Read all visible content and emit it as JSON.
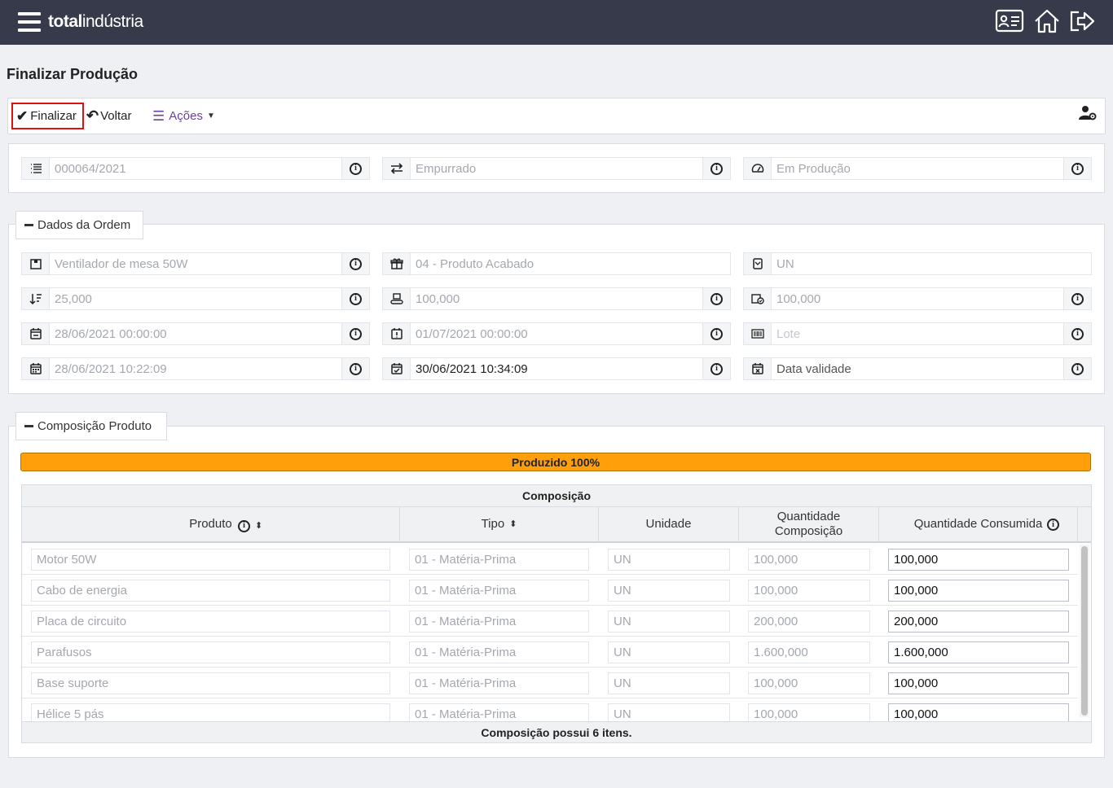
{
  "app": {
    "logo_bold": "total",
    "logo_light": "indústria"
  },
  "page": {
    "title": "Finalizar Produção"
  },
  "toolbar": {
    "finalizar": "Finalizar",
    "voltar": "Voltar",
    "acoes": "Ações"
  },
  "status_fields": {
    "order_number": "000064/2021",
    "flow_type": "Empurrado",
    "status": "Em Produção"
  },
  "dados_ordem": {
    "legend": "Dados da Ordem",
    "product": "Ventilador de mesa 50W",
    "product_type": "04 - Produto Acabado",
    "unit": "UN",
    "qty_min": "25,000",
    "qty_planned": "100,000",
    "qty_produced": "100,000",
    "planned_start": "28/06/2021 00:00:00",
    "planned_end": "01/07/2021 00:00:00",
    "lote_placeholder": "Lote",
    "actual_start": "28/06/2021 10:22:09",
    "actual_end": "30/06/2021 10:34:09",
    "validade_placeholder": "Data validade"
  },
  "composicao": {
    "legend": "Composição Produto",
    "progress_label": "Produzido 100%",
    "progress_percent": 100,
    "grid_title": "Composição",
    "columns": [
      "Produto",
      "Tipo",
      "Unidade",
      "Quantidade Composição",
      "Quantidade Consumida"
    ],
    "rows": [
      {
        "produto": "Motor 50W",
        "tipo": "01 - Matéria-Prima",
        "unidade": "UN",
        "qtd_comp": "100,000",
        "qtd_cons": "100,000"
      },
      {
        "produto": "Cabo de energia",
        "tipo": "01 - Matéria-Prima",
        "unidade": "UN",
        "qtd_comp": "100,000",
        "qtd_cons": "100,000"
      },
      {
        "produto": "Placa de circuito",
        "tipo": "01 - Matéria-Prima",
        "unidade": "UN",
        "qtd_comp": "200,000",
        "qtd_cons": "200,000"
      },
      {
        "produto": "Parafusos",
        "tipo": "01 - Matéria-Prima",
        "unidade": "UN",
        "qtd_comp": "1.600,000",
        "qtd_cons": "1.600,000"
      },
      {
        "produto": "Base suporte",
        "tipo": "01 - Matéria-Prima",
        "unidade": "UN",
        "qtd_comp": "100,000",
        "qtd_cons": "100,000"
      },
      {
        "produto": "Hélice 5 pás",
        "tipo": "01 - Matéria-Prima",
        "unidade": "UN",
        "qtd_comp": "100,000",
        "qtd_cons": "100,000"
      }
    ],
    "footer": "Composição possui 6 itens."
  },
  "colors": {
    "topbar": "#363a4b",
    "progress": "#ff9f0a",
    "acoes": "#6b3fa0",
    "highlight_border": "#dd1111"
  }
}
